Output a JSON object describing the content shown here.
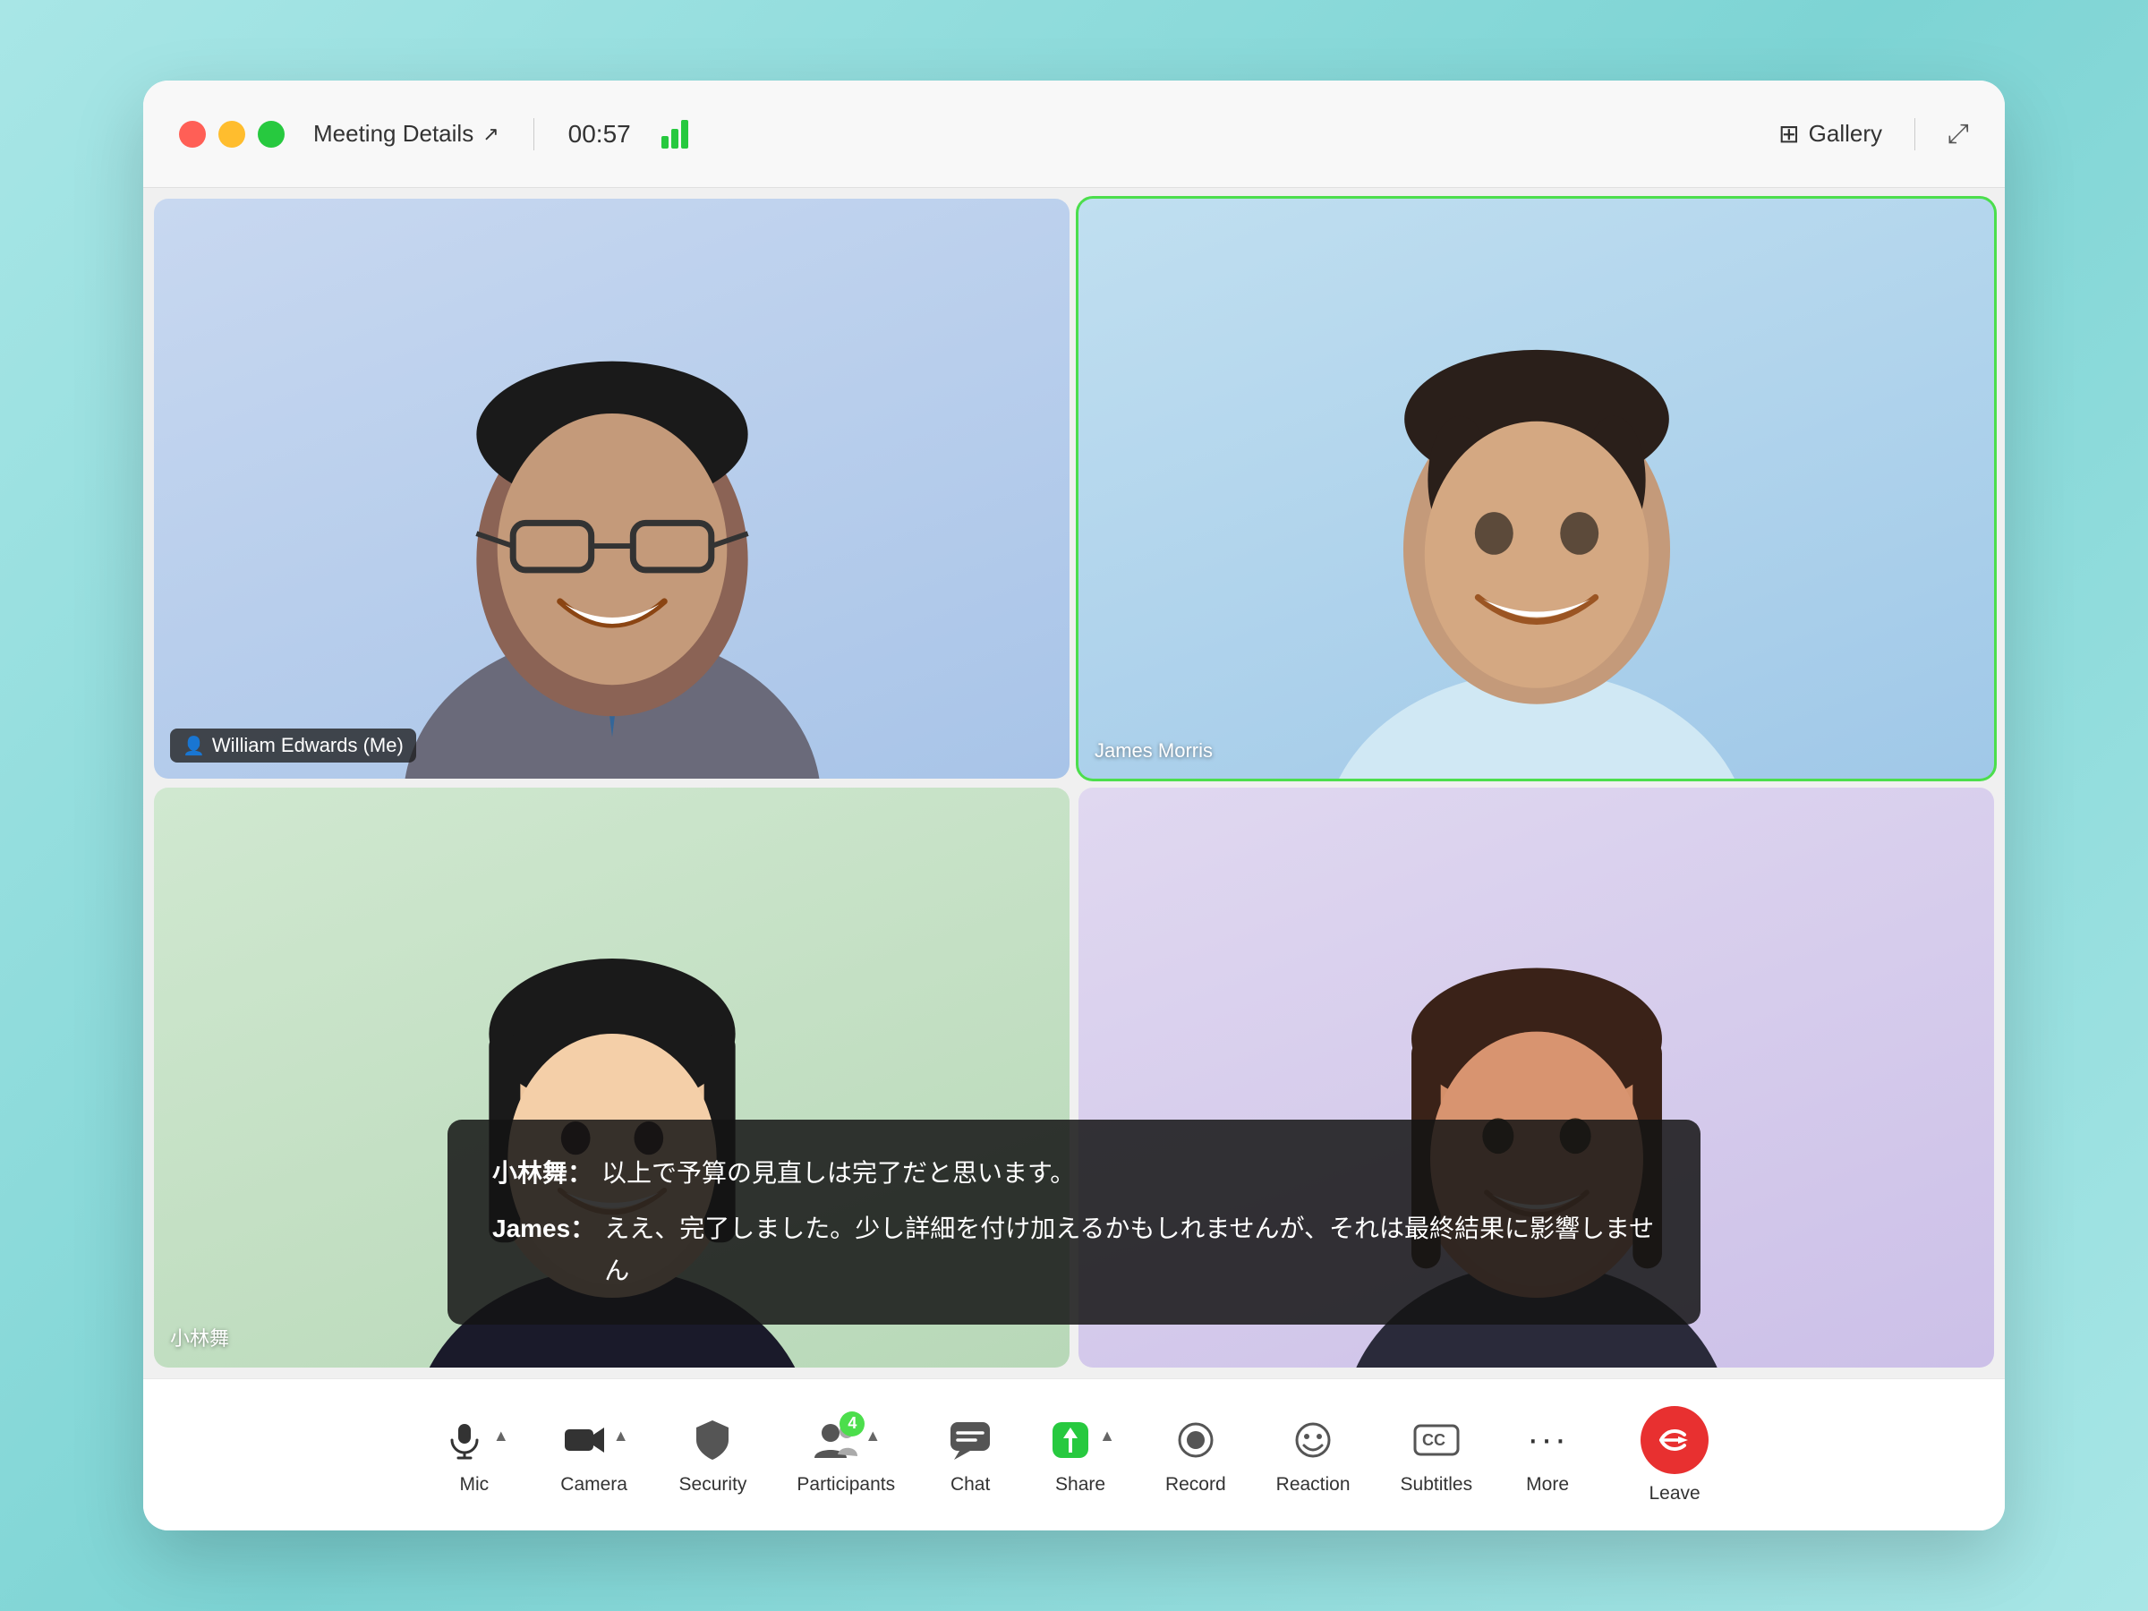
{
  "window": {
    "controls": {
      "close_color": "#ff5f56",
      "min_color": "#ffbd2e",
      "max_color": "#27c93f"
    },
    "titlebar": {
      "meeting_details_label": "Meeting Details",
      "timer": "00:57",
      "gallery_label": "Gallery"
    }
  },
  "participants": [
    {
      "id": "william",
      "name": "William Edwards (Me)",
      "bg": "blue",
      "show_icon": true,
      "active": false,
      "position": "top-left"
    },
    {
      "id": "james",
      "name": "James Morris",
      "bg": "skyblue",
      "show_icon": false,
      "active": true,
      "position": "top-right"
    },
    {
      "id": "kobayashi",
      "name": "小林舞",
      "bg": "teal",
      "show_icon": false,
      "active": false,
      "position": "bottom-left"
    },
    {
      "id": "unknown",
      "name": "",
      "bg": "purple",
      "show_icon": false,
      "active": false,
      "position": "bottom-right"
    }
  ],
  "captions": [
    {
      "speaker": "小林舞：",
      "text": "以上で予算の見直しは完了だと思います。"
    },
    {
      "speaker": "James：",
      "text": "ええ、完了しました。少し詳細を付け加えるかもしれませんが、それは最終結果に影響しません"
    }
  ],
  "toolbar": {
    "items": [
      {
        "id": "mic",
        "label": "Mic",
        "icon": "🎤",
        "has_caret": true,
        "badge": null
      },
      {
        "id": "camera",
        "label": "Camera",
        "icon": "📷",
        "has_caret": true,
        "badge": null
      },
      {
        "id": "security",
        "label": "Security",
        "icon": "🛡️",
        "has_caret": false,
        "badge": null
      },
      {
        "id": "participants",
        "label": "Participants",
        "icon": "👥",
        "has_caret": true,
        "badge": "4"
      },
      {
        "id": "chat",
        "label": "Chat",
        "icon": "💬",
        "has_caret": false,
        "badge": null
      },
      {
        "id": "share",
        "label": "Share",
        "icon": "⬆️",
        "has_caret": true,
        "badge": null
      },
      {
        "id": "record",
        "label": "Record",
        "icon": "⏺️",
        "has_caret": false,
        "badge": null
      },
      {
        "id": "reaction",
        "label": "Reaction",
        "icon": "😊",
        "has_caret": false,
        "badge": null
      },
      {
        "id": "subtitles",
        "label": "Subtitles",
        "icon": "CC",
        "has_caret": false,
        "badge": null
      },
      {
        "id": "more",
        "label": "More",
        "icon": "···",
        "has_caret": false,
        "badge": null
      }
    ],
    "leave_label": "Leave"
  }
}
